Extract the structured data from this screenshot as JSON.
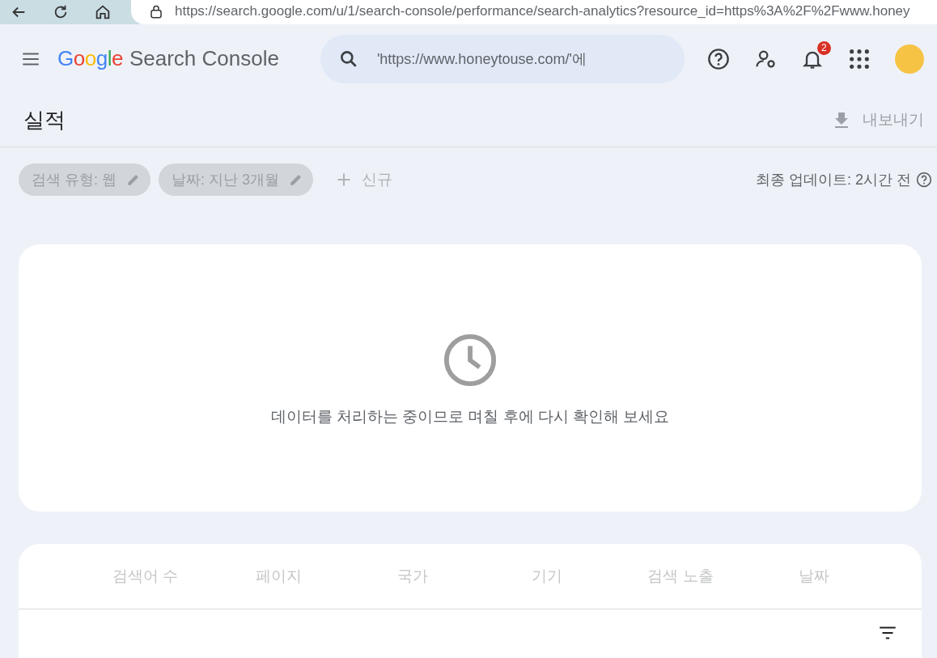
{
  "browser": {
    "url": "https://search.google.com/u/1/search-console/performance/search-analytics?resource_id=https%3A%2F%2Fwww.honey"
  },
  "header": {
    "logo": "Google",
    "product": "Search Console",
    "search": {
      "value": "'https://www.honeytouse.com/'에"
    },
    "notification_count": "2"
  },
  "page": {
    "title": "실적",
    "export": "내보내기"
  },
  "filters": [
    {
      "label": "검색 유형: 웹"
    },
    {
      "label": "날짜: 지난 3개월"
    }
  ],
  "new_filter": "신규",
  "last_updated": "최종 업데이트: 2시간 전",
  "message": "데이터를 처리하는 중이므로 며칠 후에 다시 확인해 보세요",
  "tabs": [
    {
      "label": "검색어 수"
    },
    {
      "label": "페이지"
    },
    {
      "label": "국가"
    },
    {
      "label": "기기"
    },
    {
      "label": "검색 노출"
    },
    {
      "label": "날짜"
    }
  ]
}
